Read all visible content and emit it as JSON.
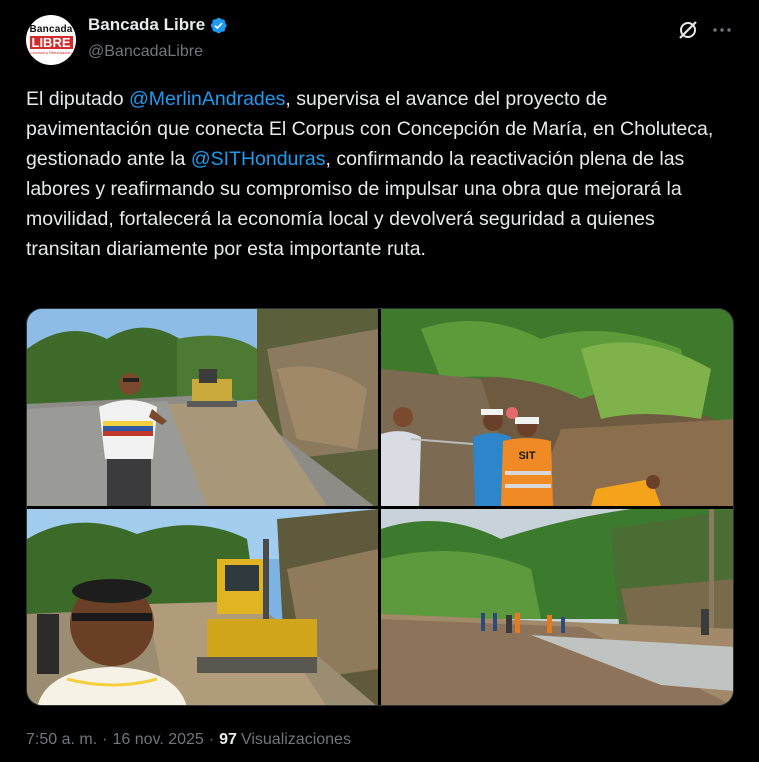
{
  "account": {
    "display_name": "Bancada Libre",
    "handle": "@BancadaLibre",
    "avatar_line1": "Bancada",
    "avatar_line2": "LIBRE",
    "avatar_line3": "Libertad y Refundación",
    "verified_color": "#1d9bf0"
  },
  "post": {
    "text_1": "El diputado ",
    "mention_1": "@MerlinAndrades",
    "text_2": ", supervisa el avance del proyecto de pavimentación que conecta El Corpus con Concepción de María, en Choluteca, gestionado ante la ",
    "mention_2": "@SITHonduras",
    "text_3": ", confirmando la reactivación plena de las labores y reafirmando su compromiso de impulsar una obra que mejorará la movilidad, fortalecerá la economía local y devolverá seguridad a quienes transitan diariamente por esta importante ruta."
  },
  "meta": {
    "time": "7:50 a. m.",
    "separator": "·",
    "date": "16 nov. 2025",
    "views_count": "97",
    "views_label": "Visualizaciones"
  },
  "icons": {
    "grok": "grok-icon",
    "more": "more-icon",
    "verified": "verified-badge-icon"
  },
  "photos": {
    "photo_2_vest_text": "SIT"
  },
  "colors": {
    "background": "#000000",
    "text": "#e7e9ea",
    "muted": "#71767b",
    "link": "#1d9bf0"
  }
}
